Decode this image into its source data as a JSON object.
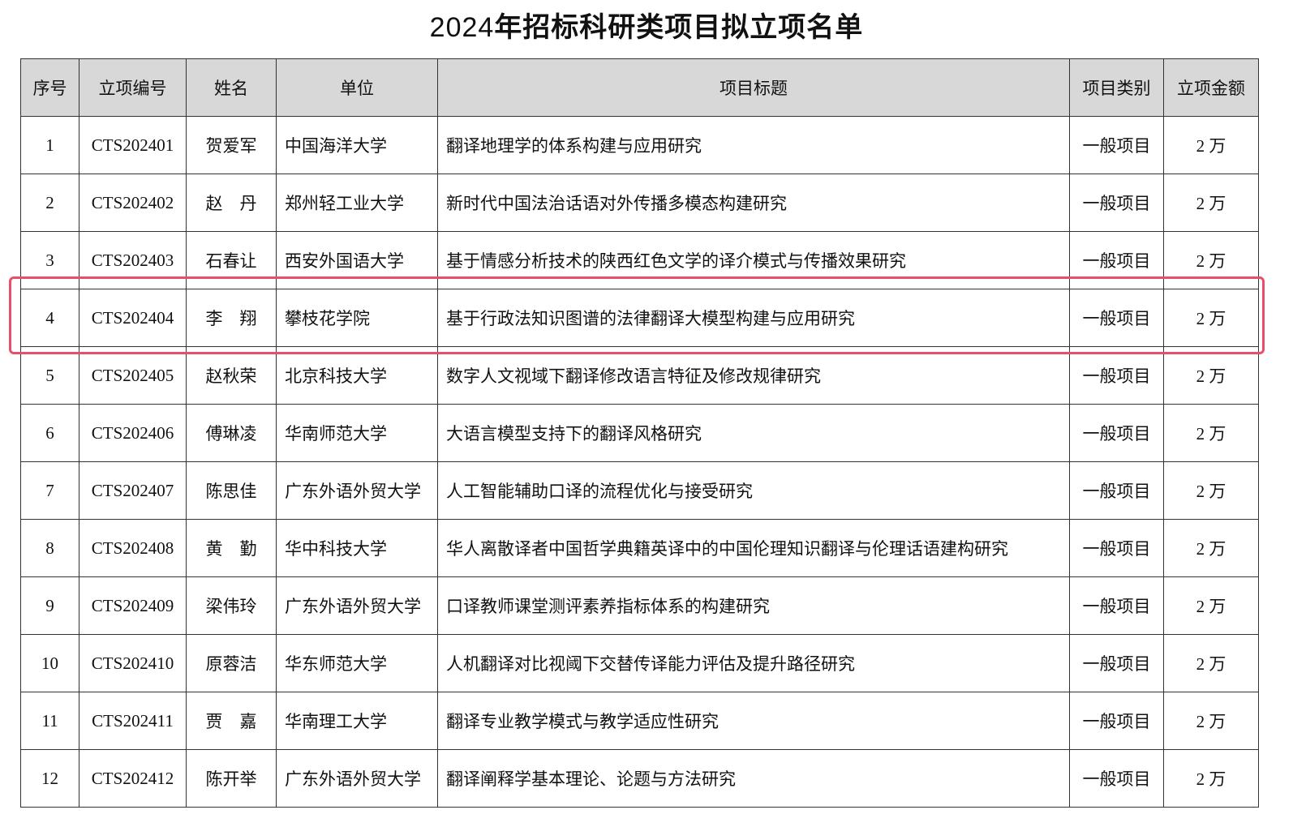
{
  "title_year": "2024",
  "title_rest": "年招标科研类项目拟立项名单",
  "headers": [
    "序号",
    "立项编号",
    "姓名",
    "单位",
    "项目标题",
    "项目类别",
    "立项金额"
  ],
  "rows": [
    [
      "1",
      "CTS202401",
      "贺爱军",
      "中国海洋大学",
      "翻译地理学的体系构建与应用研究",
      "一般项目",
      "2 万"
    ],
    [
      "2",
      "CTS202402",
      "赵　丹",
      "郑州轻工业大学",
      "新时代中国法治话语对外传播多模态构建研究",
      "一般项目",
      "2 万"
    ],
    [
      "3",
      "CTS202403",
      "石春让",
      "西安外国语大学",
      "基于情感分析技术的陕西红色文学的译介模式与传播效果研究",
      "一般项目",
      "2 万"
    ],
    [
      "4",
      "CTS202404",
      "李　翔",
      "攀枝花学院",
      "基于行政法知识图谱的法律翻译大模型构建与应用研究",
      "一般项目",
      "2 万"
    ],
    [
      "5",
      "CTS202405",
      "赵秋荣",
      "北京科技大学",
      "数字人文视域下翻译修改语言特征及修改规律研究",
      "一般项目",
      "2 万"
    ],
    [
      "6",
      "CTS202406",
      "傅琳凌",
      "华南师范大学",
      "大语言模型支持下的翻译风格研究",
      "一般项目",
      "2 万"
    ],
    [
      "7",
      "CTS202407",
      "陈思佳",
      "广东外语外贸大学",
      "人工智能辅助口译的流程优化与接受研究",
      "一般项目",
      "2 万"
    ],
    [
      "8",
      "CTS202408",
      "黄　勤",
      "华中科技大学",
      "华人离散译者中国哲学典籍英译中的中国伦理知识翻译与伦理话语建构研究",
      "一般项目",
      "2 万"
    ],
    [
      "9",
      "CTS202409",
      "梁伟玲",
      "广东外语外贸大学",
      "口译教师课堂测评素养指标体系的构建研究",
      "一般项目",
      "2 万"
    ],
    [
      "10",
      "CTS202410",
      "原蓉洁",
      "华东师范大学",
      "人机翻译对比视阈下交替传译能力评估及提升路径研究",
      "一般项目",
      "2 万"
    ],
    [
      "11",
      "CTS202411",
      "贾　嘉",
      "华南理工大学",
      "翻译专业教学模式与教学适应性研究",
      "一般项目",
      "2 万"
    ],
    [
      "12",
      "CTS202412",
      "陈开举",
      "广东外语外贸大学",
      "翻译阐释学基本理论、论题与方法研究",
      "一般项目",
      "2 万"
    ]
  ],
  "highlight_row": 3,
  "colors": {
    "header_bg": "#d8d8d8",
    "border": "#333333",
    "highlight": "#e8506a"
  }
}
